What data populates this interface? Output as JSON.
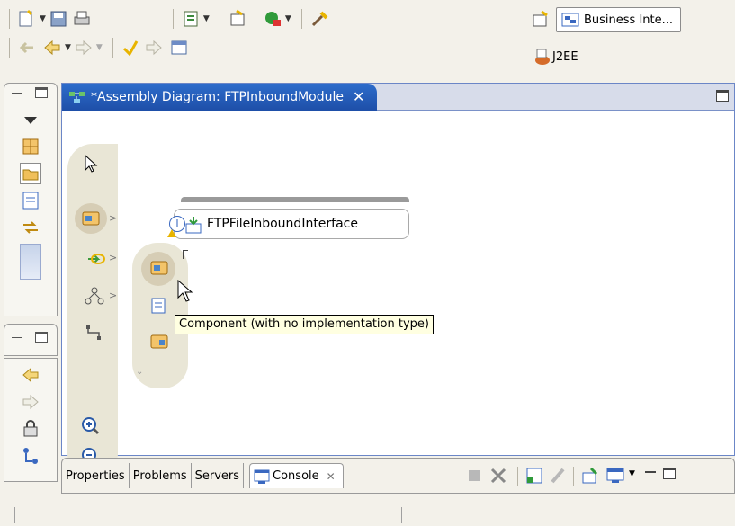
{
  "perspectives": {
    "active_label": "Business Inte...",
    "secondary_label": "J2EE"
  },
  "editor": {
    "tab_title": "*Assembly Diagram: FTPInboundModule",
    "tab_close_glyph": "✕"
  },
  "diagram": {
    "interface_component_label": "FTPFileInboundInterface",
    "tooltip": "Component (with no implementation type)"
  },
  "bottom_tabs": [
    {
      "label": "Properties"
    },
    {
      "label": "Problems"
    },
    {
      "label": "Servers"
    },
    {
      "label": "Console"
    }
  ],
  "icons": {
    "toolbar": [
      "new-wizard-icon",
      "save-icon",
      "print-icon",
      "new-module-icon",
      "open-type-icon",
      "run-icon",
      "external-tools-icon",
      "back-icon",
      "forward-icon"
    ],
    "palette": [
      "selection-arrow-icon",
      "component-icon",
      "import-export-icon",
      "wiring-icon",
      "connection-icon",
      "zoom-in-icon",
      "zoom-out-icon"
    ]
  },
  "colors": {
    "active_tab": "#2d6dcb",
    "palette_bg": "#e9e6d6",
    "tooltip_bg": "#ffffe1"
  }
}
